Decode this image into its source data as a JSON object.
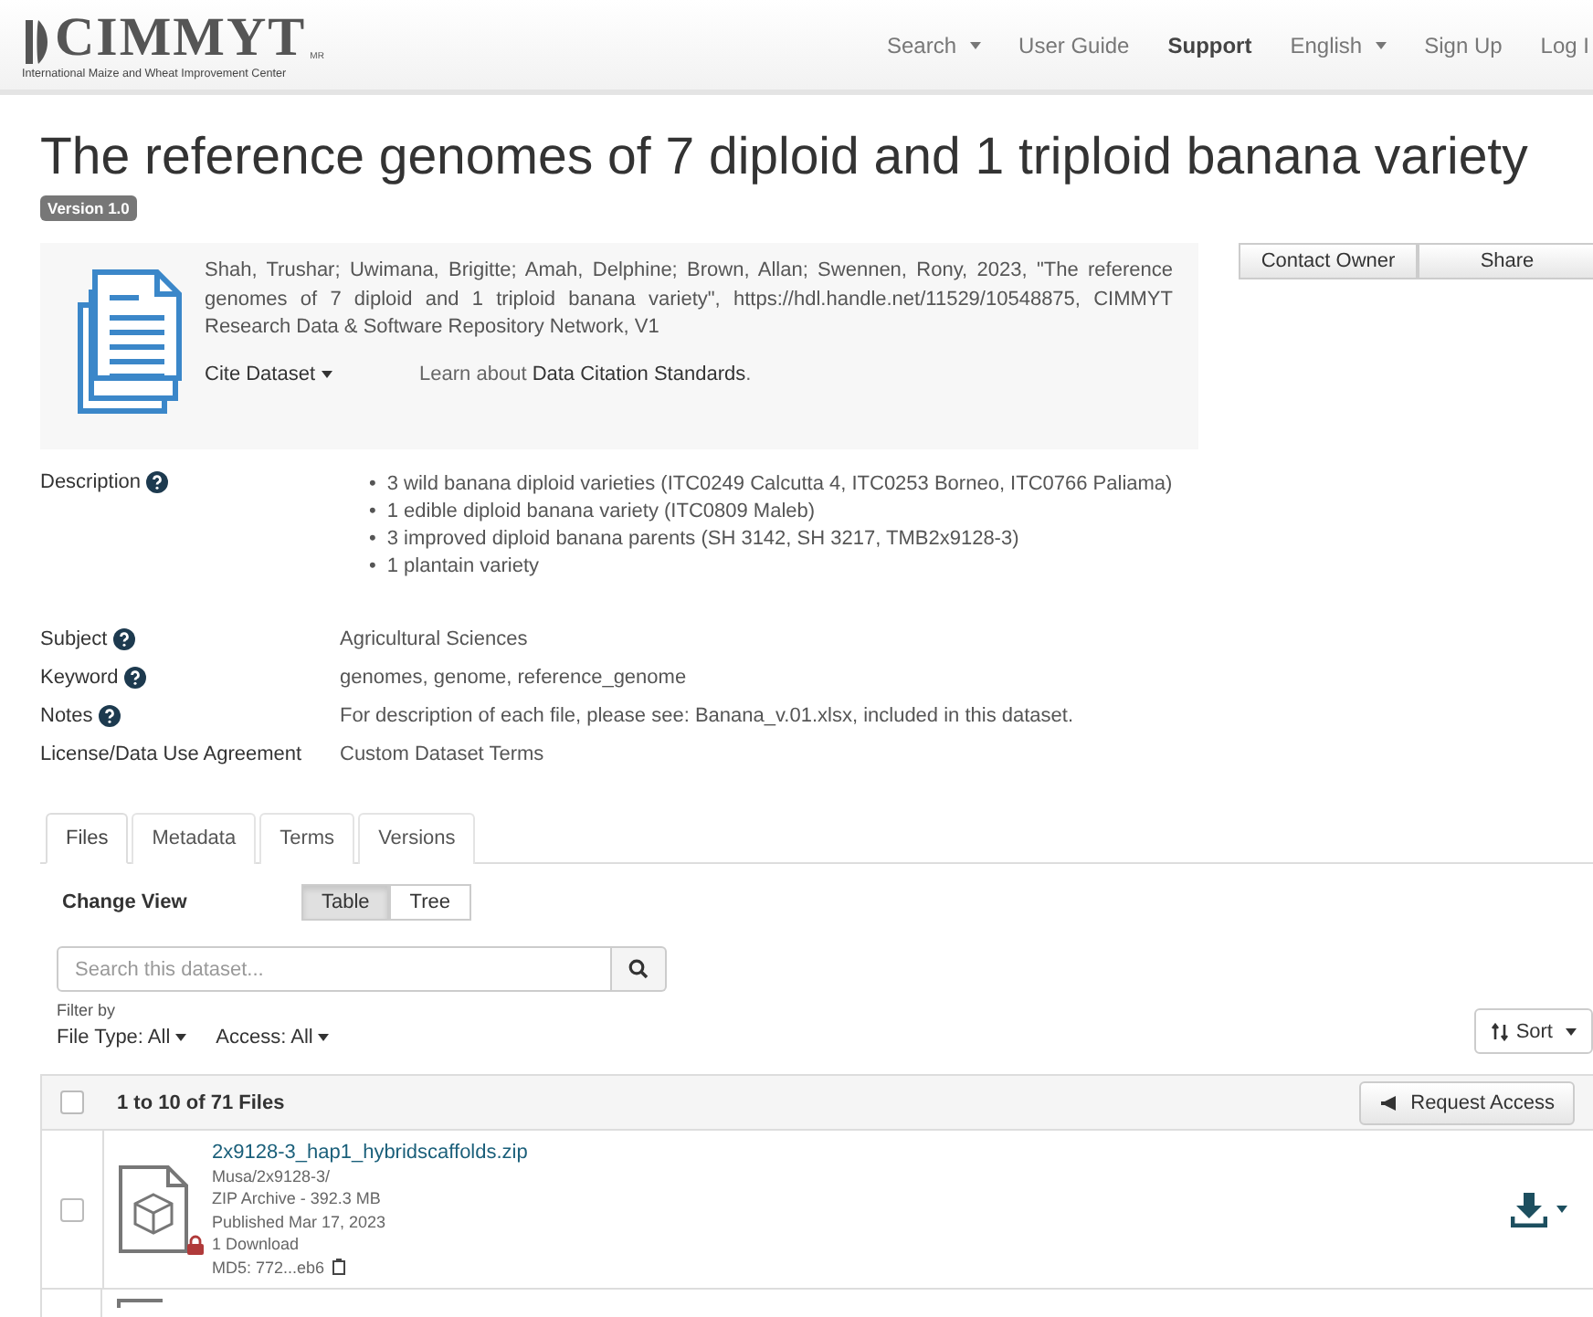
{
  "header": {
    "logo": {
      "name": "CIMMYT",
      "mark": "MR",
      "subtitle": "International Maize and Wheat Improvement Center"
    },
    "nav": [
      {
        "label": "Search",
        "dropdown": true,
        "bold": false
      },
      {
        "label": "User Guide",
        "dropdown": false,
        "bold": false
      },
      {
        "label": "Support",
        "dropdown": false,
        "bold": true
      },
      {
        "label": "English",
        "dropdown": true,
        "bold": false
      },
      {
        "label": "Sign Up",
        "dropdown": false,
        "bold": false
      },
      {
        "label": "Log I",
        "dropdown": false,
        "bold": false
      }
    ]
  },
  "title": "The reference genomes of 7 diploid and 1 triploid banana variety",
  "version": "Version 1.0",
  "citation": {
    "text": "Shah, Trushar; Uwimana, Brigitte; Amah, Delphine; Brown, Allan; Swennen, Rony, 2023, \"The reference genomes of 7 diploid and 1 triploid banana variety\", https://hdl.handle.net/11529/10548875, CIMMYT Research Data & Software Repository Network, V1",
    "cite_button": "Cite Dataset",
    "learn_prefix": "Learn about",
    "learn_link": "Data Citation Standards",
    "learn_suffix": "."
  },
  "actions": [
    "Contact Owner",
    "Share"
  ],
  "metadata": [
    {
      "label": "Description",
      "help": true,
      "kind": "list",
      "marker": "•",
      "items": [
        "3 wild banana diploid varieties (ITC0249 Calcutta 4, ITC0253 Borneo, ITC0766 Paliama)",
        "1 edible diploid banana variety (ITC0809 Maleb)",
        "3 improved diploid banana parents (SH 3142, SH 3217, TMB2x9128-3)",
        "1 plantain variety"
      ]
    },
    {
      "label": "Subject",
      "help": true,
      "kind": "text",
      "value": "Agricultural Sciences"
    },
    {
      "label": "Keyword",
      "help": true,
      "kind": "text",
      "value": "genomes, genome, reference_genome"
    },
    {
      "label": "Notes",
      "help": true,
      "kind": "text",
      "value": "For description of each file, please see: Banana_v.01.xlsx, included in this dataset."
    },
    {
      "label": "License/Data Use Agreement",
      "help": false,
      "kind": "text",
      "value": "Custom Dataset Terms"
    }
  ],
  "tabs": [
    {
      "label": "Files",
      "selected": true
    },
    {
      "label": "Metadata",
      "selected": false
    },
    {
      "label": "Terms",
      "selected": false
    },
    {
      "label": "Versions",
      "selected": false
    }
  ],
  "change_view": {
    "label": "Change View",
    "options": [
      {
        "label": "Table",
        "selected": true
      },
      {
        "label": "Tree",
        "selected": false
      }
    ]
  },
  "search": {
    "placeholder": "Search this dataset..."
  },
  "filter": {
    "label": "Filter by",
    "options": [
      "File Type: All",
      "Access: All"
    ]
  },
  "sort": "Sort",
  "files_header": {
    "count": "1 to 10 of 71 Files",
    "request": "Request Access",
    "checked": false
  },
  "files": [
    {
      "name": "2x9128-3_hap1_hybridscaffolds.zip",
      "path": "Musa/2x9128-3/",
      "type": "ZIP Archive - 392.3 MB",
      "published": "Published Mar 17, 2023",
      "downloads": "1 Download",
      "md5": "MD5: 772...eb6",
      "restricted": true,
      "checked": false
    }
  ]
}
